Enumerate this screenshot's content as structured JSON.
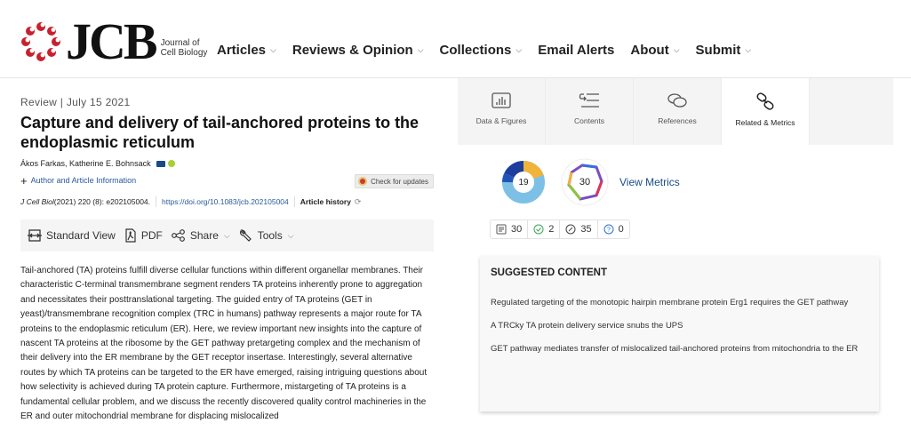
{
  "header": {
    "logo_text": "JCB",
    "logo_subtitle_line1": "Journal of",
    "logo_subtitle_line2": "Cell Biology",
    "nav": [
      {
        "label": "Articles",
        "has_dropdown": true
      },
      {
        "label": "Reviews & Opinion",
        "has_dropdown": true
      },
      {
        "label": "Collections",
        "has_dropdown": true
      },
      {
        "label": "Email Alerts",
        "has_dropdown": false
      },
      {
        "label": "About",
        "has_dropdown": true
      },
      {
        "label": "Submit",
        "has_dropdown": true
      }
    ],
    "dropdown_glyph": "⌄",
    "brand_color": "#c8202f"
  },
  "article": {
    "type_date": "Review | July 15 2021",
    "title": "Capture and delivery of tail-anchored proteins to the endoplasmic reticulum",
    "authors": "Ákos Farkas, Katherine E. Bohnsack",
    "author_info_label": "Author and Article Information",
    "check_updates_label": "Check for updates",
    "citation": {
      "journal": "J Cell Biol",
      "details": " (2021) 220 (8): e202105004.",
      "doi": "https://doi.org/10.1083/jcb.202105004",
      "history_label": "Article history"
    },
    "toolbar": {
      "standard_view": "Standard View",
      "pdf": "PDF",
      "share": "Share",
      "tools": "Tools"
    },
    "abstract": "Tail-anchored (TA) proteins fulfill diverse cellular functions within different organellar membranes. Their characteristic C-terminal transmembrane segment renders TA proteins inherently prone to aggregation and necessitates their posttranslational targeting. The guided entry of TA proteins (GET in yeast)/transmembrane recognition complex (TRC in humans) pathway represents a major route for TA proteins to the endoplasmic reticulum (ER). Here, we review important new insights into the capture of nascent TA proteins at the ribosome by the GET pathway pretargeting complex and the mechanism of their delivery into the ER membrane by the GET receptor insertase. Interestingly, several alternative routes by which TA proteins can be targeted to the ER have emerged, raising intriguing questions about how selectivity is achieved during TA protein capture. Furthermore, mistargeting of TA proteins is a fundamental cellular problem, and we discuss the recently discovered quality control machineries in the ER and outer mitochondrial membrane for displacing mislocalized"
  },
  "side_tabs": [
    {
      "label": "Data & Figures",
      "icon": "bar-chart-icon",
      "active": false
    },
    {
      "label": "Contents",
      "icon": "contents-list-icon",
      "active": false
    },
    {
      "label": "References",
      "icon": "references-icon",
      "active": false
    },
    {
      "label": "Related & Metrics",
      "icon": "link-icon",
      "active": true
    }
  ],
  "metrics": {
    "altmetric_score": "19",
    "dimensions_citations": "30",
    "view_metrics_label": "View Metrics",
    "counts": [
      {
        "icon": "document-icon",
        "value": "30",
        "color": "#555555"
      },
      {
        "icon": "check-circle-icon",
        "value": "2",
        "color": "#3aa657"
      },
      {
        "icon": "contrast-circle-icon",
        "value": "35",
        "color": "#444444"
      },
      {
        "icon": "question-circle-icon",
        "value": "0",
        "color": "#2f6fd1"
      }
    ]
  },
  "suggested": {
    "heading": "SUGGESTED CONTENT",
    "items": [
      "Regulated targeting of the monotopic hairpin membrane protein Erg1 requires the GET pathway",
      "A TRCky TA protein delivery service snubs the UPS",
      "GET pathway mediates transfer of mislocalized tail-anchored proteins from mitochondria to the ER"
    ]
  }
}
